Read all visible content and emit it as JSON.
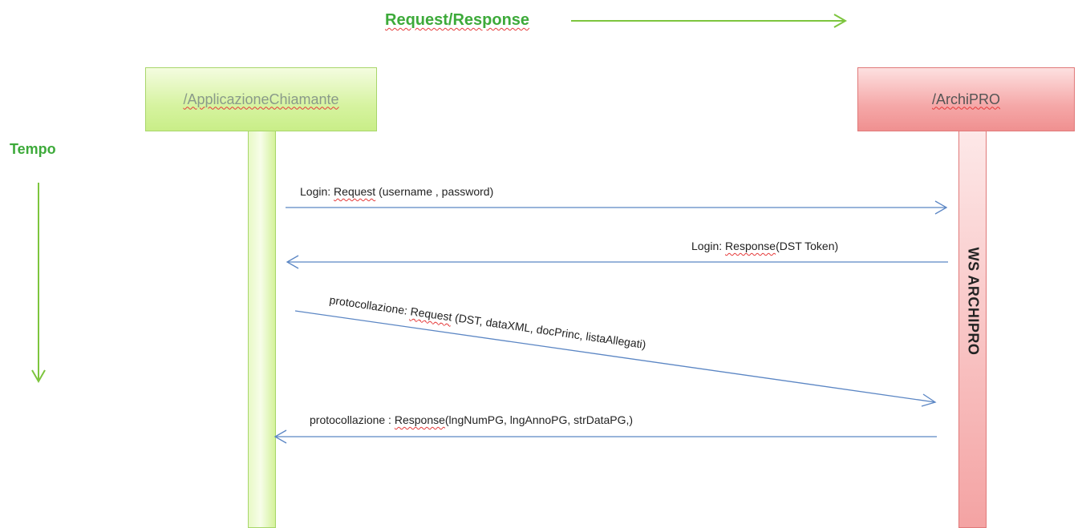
{
  "header": {
    "legend_label": "Request/Response"
  },
  "time": {
    "label": "Tempo"
  },
  "participants": {
    "caller": {
      "label": "/ApplicazioneChiamante"
    },
    "service": {
      "label": "/ArchiPRO",
      "lifeline_label": "WS ARCHIPRO"
    }
  },
  "messages": [
    {
      "prefix": "Login: ",
      "word": "Request",
      "suffix": " (username , password)",
      "direction": "caller-to-service"
    },
    {
      "prefix": "Login:  ",
      "word": "Response",
      "suffix": "(DST Token)",
      "direction": "service-to-caller"
    },
    {
      "prefix": "protocollazione: ",
      "word": "Request",
      "suffix": " (DST, dataXML, docPrinc, listaAllegati)",
      "direction": "caller-to-service"
    },
    {
      "prefix": "protocollazione : ",
      "word": "Response",
      "suffix": "(lngNumPG, lngAnnoPG,  strDataPG,)",
      "direction": "service-to-caller"
    }
  ],
  "colors": {
    "accent_green": "#3daa3a",
    "message_arrow": "#5b86c4",
    "caller_fill": "#d6f3a0",
    "service_fill": "#f5a8a8",
    "squiggle": "#e53a3a"
  }
}
